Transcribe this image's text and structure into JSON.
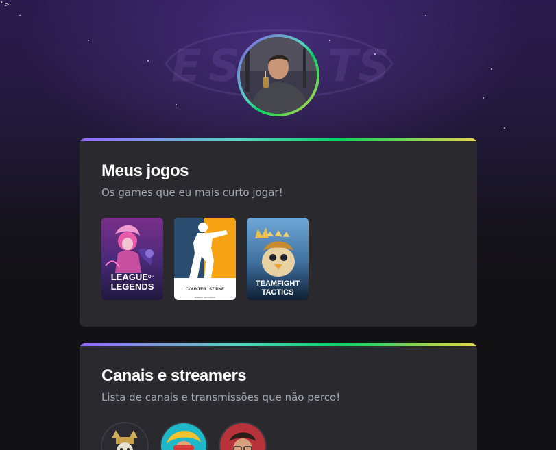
{
  "stray_text": "\">",
  "profile": {
    "avatar_alt": "profile-photo"
  },
  "games_section": {
    "title": "Meus jogos",
    "subtitle": "Os games que eu mais curto jogar!",
    "games": [
      {
        "name": "League of Legends",
        "logo_line1": "LEAGUE",
        "logo_of": "OF",
        "logo_line2": "LEGENDS"
      },
      {
        "name": "Counter-Strike",
        "logo_text_a": "COUNTER",
        "logo_text_b": "STRIKE",
        "logo_sub": "GLOBAL OFFENSIVE"
      },
      {
        "name": "Teamfight Tactics",
        "logo_line1": "TEAMFIGHT",
        "logo_line2": "TACTICS"
      }
    ]
  },
  "channels_section": {
    "title": "Canais e streamers",
    "subtitle": "Lista de canais e transmissões que não perco!"
  },
  "colors": {
    "background": "#121214",
    "card": "#29292e",
    "accent_purple": "#8257e5",
    "accent_green": "#04d361",
    "accent_yellow": "#e5d44c",
    "muted_text": "#a8a8b3"
  }
}
